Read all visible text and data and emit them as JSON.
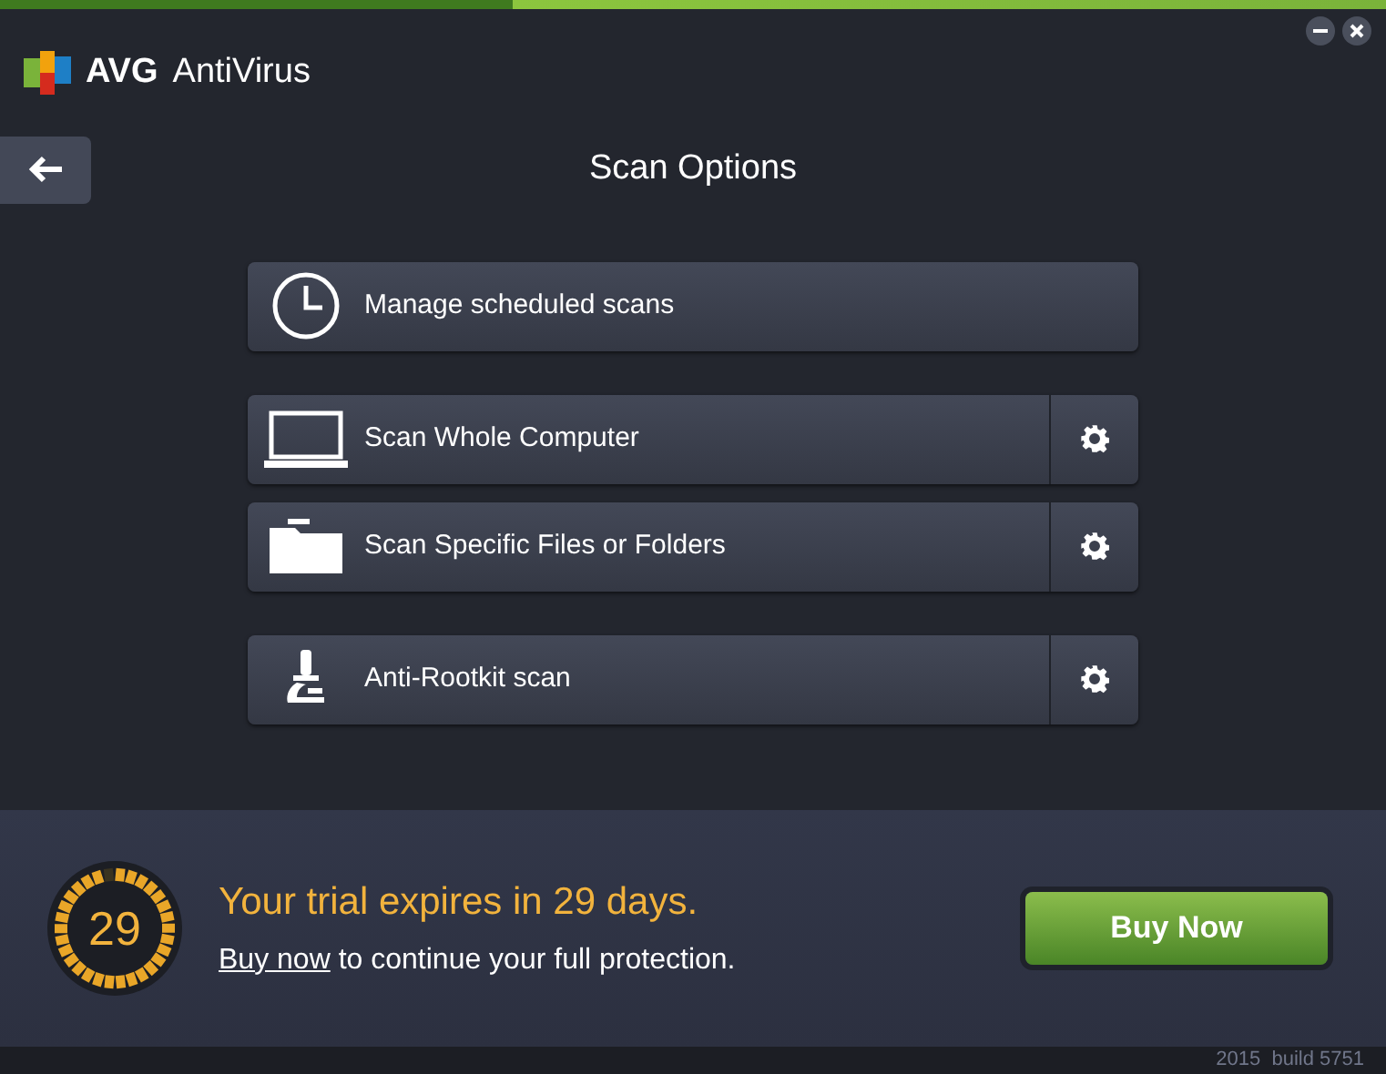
{
  "header": {
    "brand": "AVG",
    "product": "AntiVirus"
  },
  "title": "Scan Options",
  "scans": [
    {
      "kind": "plain",
      "label": "Manage scheduled scans"
    },
    {
      "kind": "with_settings",
      "label": "Scan Whole Computer"
    },
    {
      "kind": "with_settings",
      "label": "Scan Specific Files or Folders"
    },
    {
      "kind": "with_settings",
      "label": "Anti-Rootkit scan"
    }
  ],
  "trial": {
    "days": "29",
    "headline": "Your trial expires in 29 days.",
    "link": "Buy now",
    "rest": "to continue your full protection.",
    "button": "Buy Now"
  },
  "footer": {
    "version": "2015  build 5751"
  }
}
